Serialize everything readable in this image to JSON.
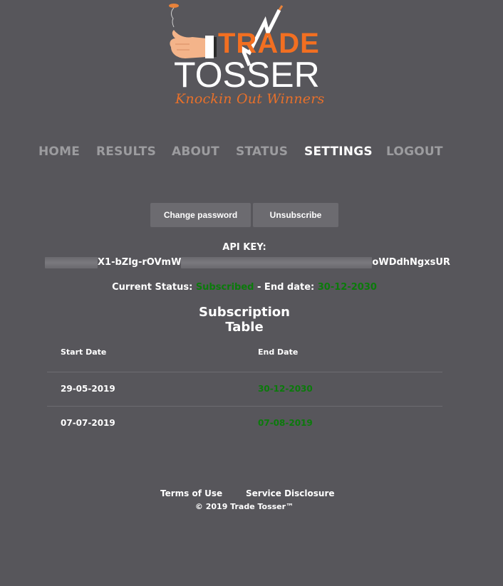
{
  "brand": {
    "name_top": "TRADE",
    "name_bottom": "TOSSER",
    "tagline": "Knockin Out Winners",
    "colors": {
      "orange": "#f26f21",
      "background": "#57565b",
      "green": "#0b7a0b"
    }
  },
  "nav": {
    "items": [
      {
        "label": "HOME",
        "active": false
      },
      {
        "label": "RESULTS",
        "active": false
      },
      {
        "label": "ABOUT",
        "active": false
      },
      {
        "label": "STATUS",
        "active": false
      },
      {
        "label": "SETTINGS",
        "active": true
      },
      {
        "label": "LOGOUT",
        "active": false
      }
    ]
  },
  "actions": {
    "change_password": "Change password",
    "unsubscribe": "Unsubscribe"
  },
  "api": {
    "label": "API KEY:",
    "visible_part_1": "X1-bZlg-rOVmW",
    "visible_part_2": "oWDdhNgxsUR"
  },
  "status": {
    "label": "Current Status:",
    "value": "Subscribed",
    "end_label": "- End date:",
    "end_value": "30-12-2030"
  },
  "subscription_table": {
    "title_line1": "Subscription",
    "title_line2": "Table",
    "columns": [
      "Start Date",
      "End Date"
    ],
    "rows": [
      {
        "start": "29-05-2019",
        "end": "30-12-2030"
      },
      {
        "start": "07-07-2019",
        "end": "07-08-2019"
      }
    ]
  },
  "footer": {
    "terms": "Terms of Use",
    "disclosure": "Service Disclosure",
    "copyright": "© 2019 Trade Tosser™"
  }
}
